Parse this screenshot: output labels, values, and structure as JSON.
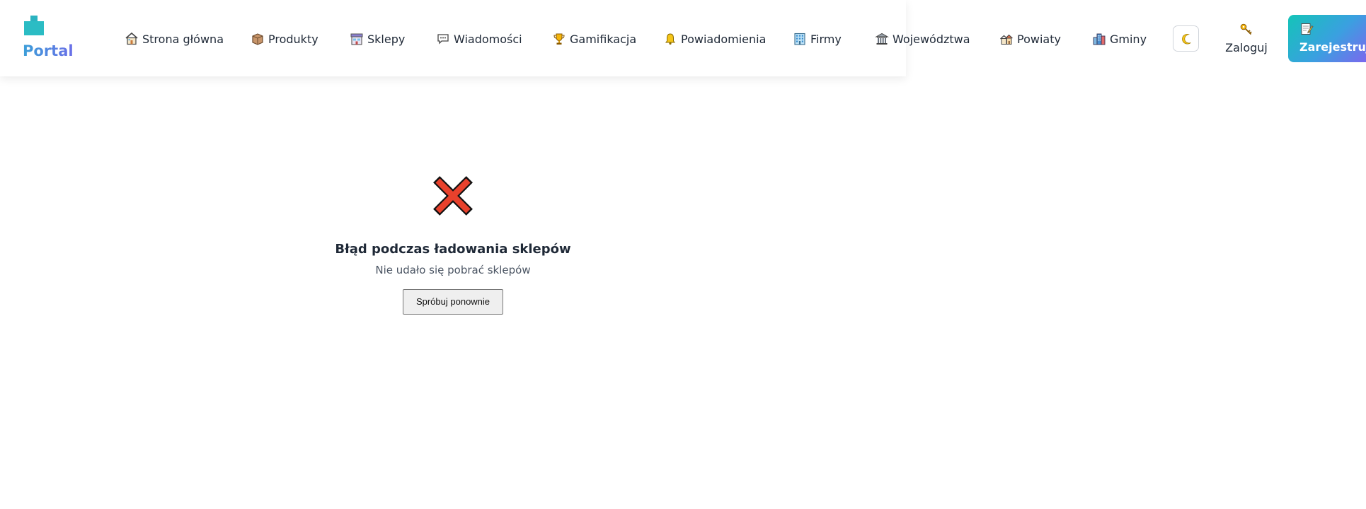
{
  "header": {
    "logo_text": "Portal",
    "nav": [
      {
        "label": "Strona główna",
        "icon": "home-icon"
      },
      {
        "label": "Produkty",
        "icon": "package-icon"
      },
      {
        "label": "Sklepy",
        "icon": "store-icon"
      },
      {
        "label": "Wiadomości",
        "icon": "chat-bubble-icon"
      },
      {
        "label": "Gamifikacja",
        "icon": "trophy-icon"
      },
      {
        "label": "Powiadomienia",
        "icon": "bell-icon"
      },
      {
        "label": "Firmy",
        "icon": "office-building-icon"
      },
      {
        "label": "Województwa",
        "icon": "classical-building-icon"
      },
      {
        "label": "Powiaty",
        "icon": "houses-icon"
      },
      {
        "label": "Gminy",
        "icon": "city-icon"
      }
    ],
    "theme_toggle_icon": "moon-icon",
    "login_label": "Zaloguj",
    "login_icon": "key-icon",
    "register_label": "Zarejestruj",
    "register_icon": "memo-icon"
  },
  "error": {
    "icon": "cross-mark-icon",
    "title": "Błąd podczas ładowania sklepów",
    "message": "Nie udało się pobrać sklepów",
    "retry_label": "Spróbuj ponownie"
  },
  "colors": {
    "brand_gradient_start": "#14c4b8",
    "brand_gradient_end": "#7b68ee",
    "error_red": "#e8412c",
    "text_dark": "#1f2937"
  }
}
